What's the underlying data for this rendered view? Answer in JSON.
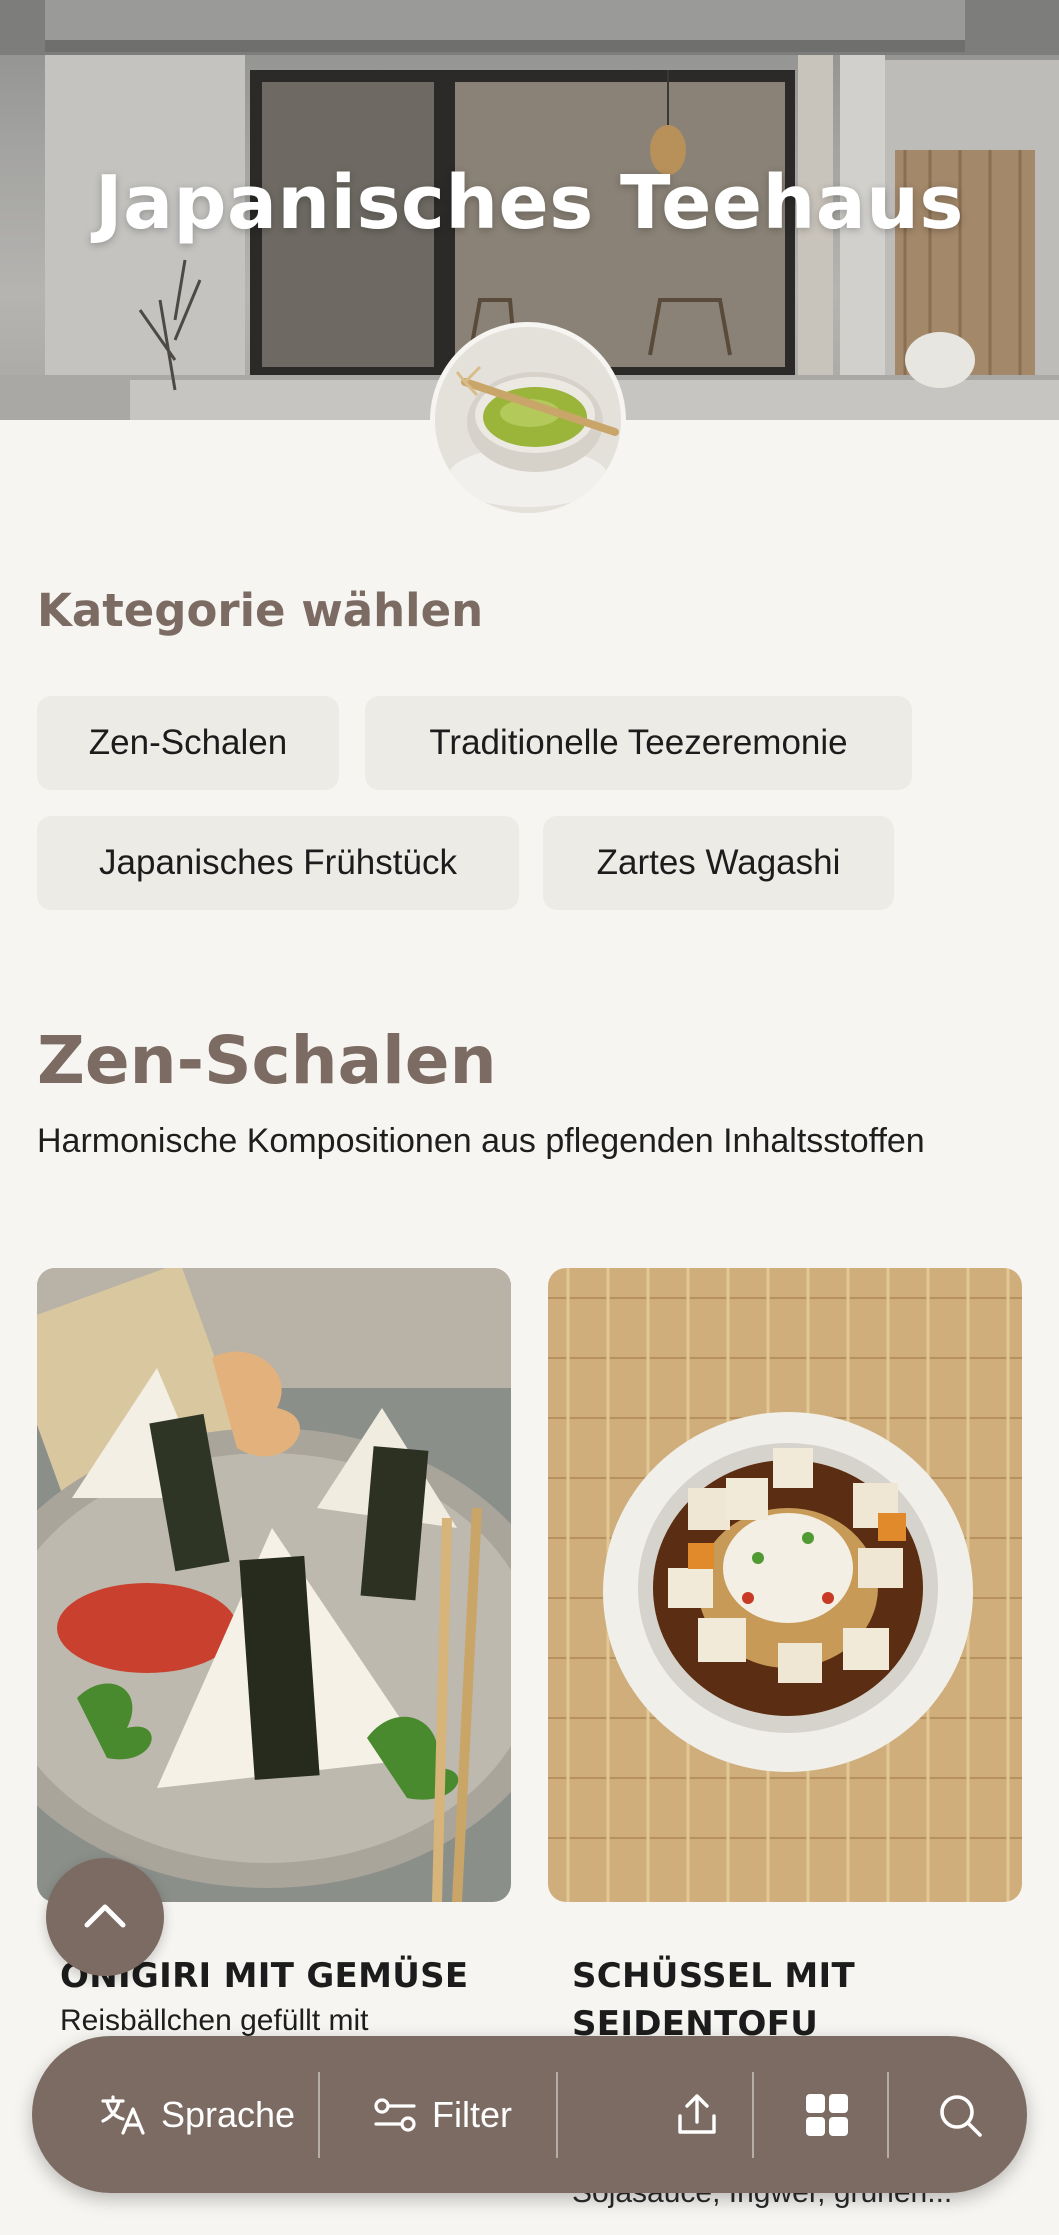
{
  "hero": {
    "title": "Japanisches Teehaus"
  },
  "categories": {
    "heading": "Kategorie wählen",
    "chips": [
      {
        "label": "Zen-Schalen"
      },
      {
        "label": "Traditionelle Teezeremonie"
      },
      {
        "label": "Japanisches Frühstück"
      },
      {
        "label": "Zartes Wagashi"
      }
    ]
  },
  "section": {
    "title": "Zen-Schalen",
    "description": "Harmonische Kompositionen aus pflegenden Inhaltsstoffen",
    "items": [
      {
        "title": "ONIGIRI MIT GEMÜSE",
        "description": "Reisbällchen gefüllt mit"
      },
      {
        "title": "SCHÜSSEL MIT SEIDENTOFU",
        "description": "Sojasauce, Ingwer, grünen..."
      }
    ]
  },
  "bottom_bar": {
    "language_label": "Sprache",
    "filter_label": "Filter",
    "icons": [
      "translate-icon",
      "filter-icon",
      "share-icon",
      "grid-icon",
      "search-icon"
    ]
  },
  "colors": {
    "accent": "#7c6b62",
    "background": "#f6f5f1",
    "chip": "#edebe6"
  }
}
